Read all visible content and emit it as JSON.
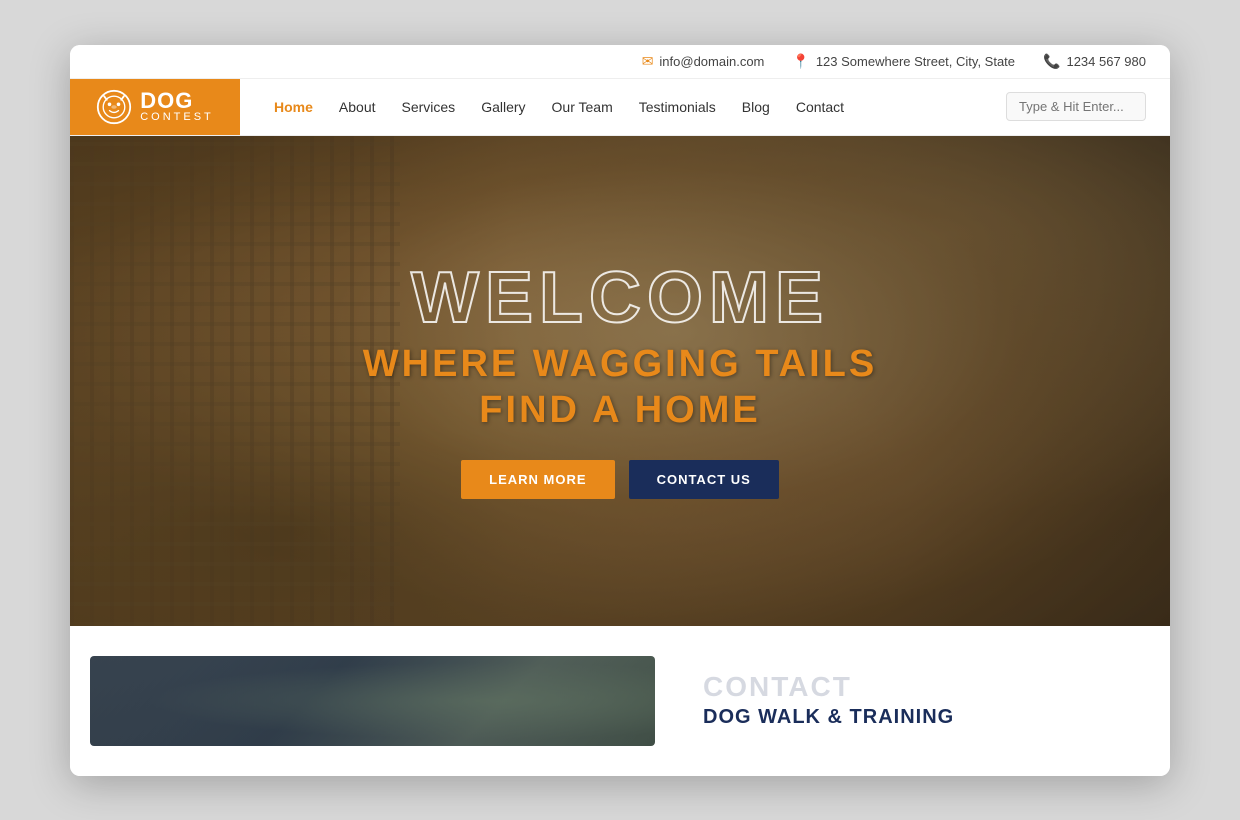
{
  "topbar": {
    "email": "info@domain.com",
    "address": "123 Somewhere Street, City, State",
    "phone": "1234 567 980"
  },
  "logo": {
    "brand": "DOG",
    "subtitle": "CONTEST"
  },
  "nav": {
    "items": [
      {
        "label": "Home",
        "active": true
      },
      {
        "label": "About",
        "active": false
      },
      {
        "label": "Services",
        "active": false
      },
      {
        "label": "Gallery",
        "active": false
      },
      {
        "label": "Our Team",
        "active": false
      },
      {
        "label": "Testimonials",
        "active": false
      },
      {
        "label": "Blog",
        "active": false
      },
      {
        "label": "Contact",
        "active": false
      }
    ],
    "search_placeholder": "Type & Hit Enter..."
  },
  "hero": {
    "welcome": "WELCOME",
    "tagline_line1": "WHERE WAGGING TAILS",
    "tagline_line2": "FIND A HOME",
    "btn_learn": "LEARN MORE",
    "btn_contact": "CONTACT US"
  },
  "below": {
    "ghost_label": "CONTACT",
    "title": "DOG WALK & TRAINING"
  }
}
